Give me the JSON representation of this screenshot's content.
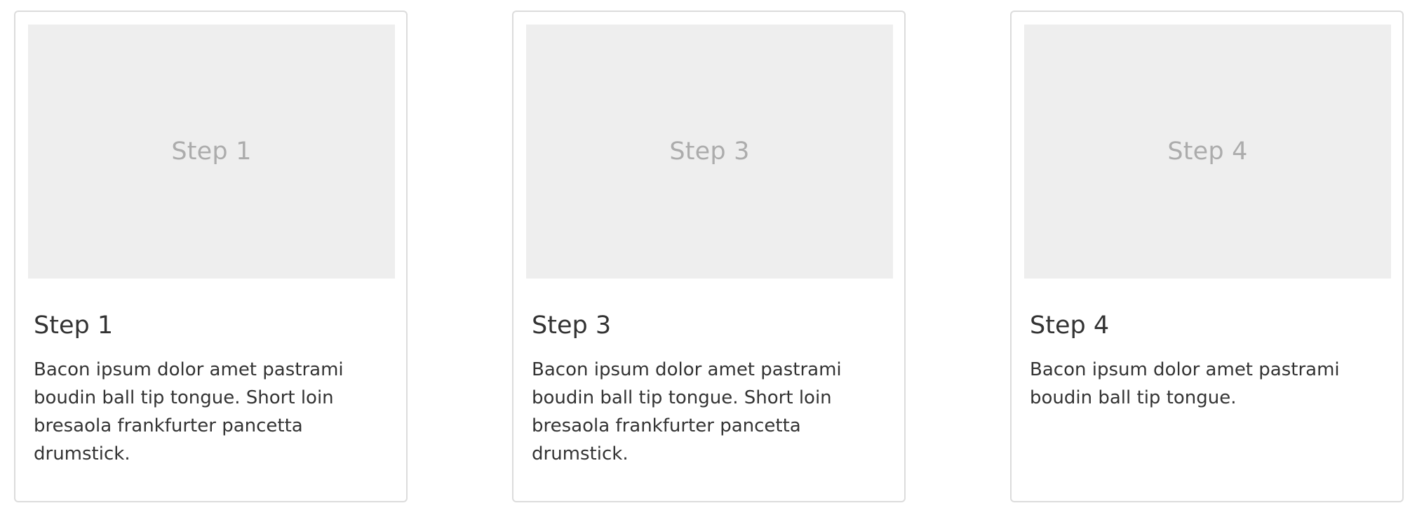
{
  "cards": [
    {
      "image_label": "Step 1",
      "title": "Step 1",
      "description": "Bacon ipsum dolor amet pastrami boudin ball tip tongue. Short loin bresaola frankfurter pancetta drumstick."
    },
    {
      "image_label": "Step 3",
      "title": "Step 3",
      "description": "Bacon ipsum dolor amet pastrami boudin ball tip tongue. Short loin bresaola frankfurter pancetta drumstick."
    },
    {
      "image_label": "Step 4",
      "title": "Step 4",
      "description": "Bacon ipsum dolor amet pastrami boudin ball tip tongue."
    }
  ],
  "colors": {
    "card_border": "#dcdcdc",
    "thumb_background": "#eeeeee",
    "thumb_text": "#acacac",
    "body_text": "#333333"
  }
}
